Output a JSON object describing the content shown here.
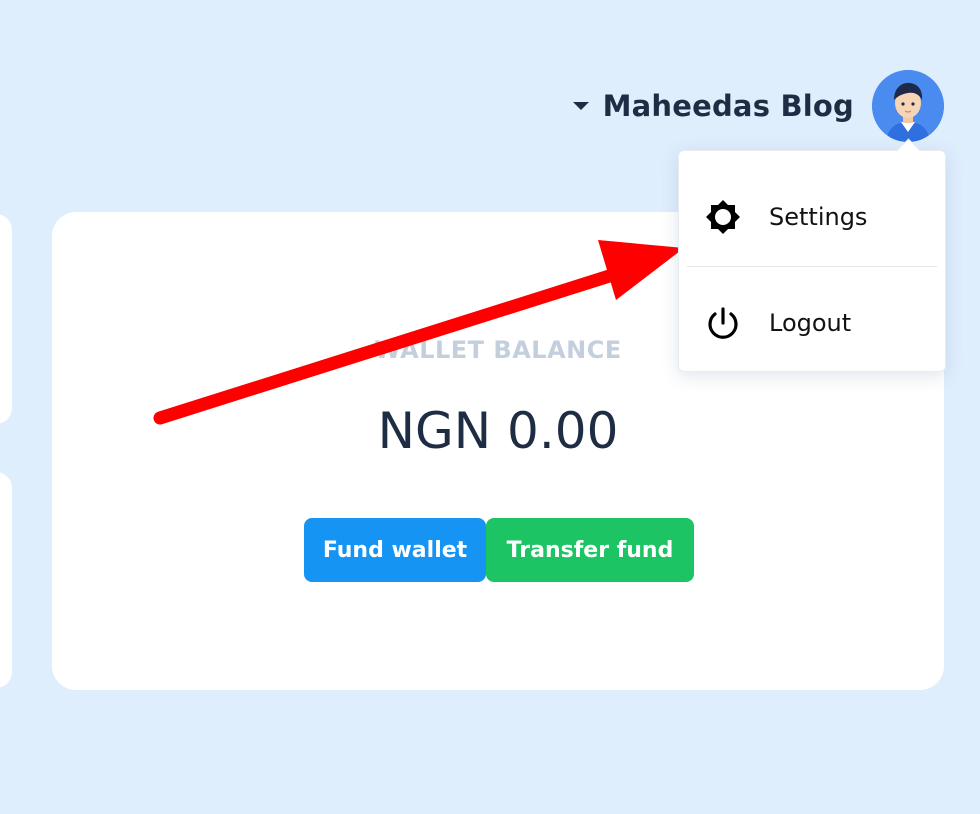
{
  "header": {
    "user_name": "Maheedas Blog",
    "avatar_icon": "user-avatar-icon"
  },
  "wallet": {
    "label": "WALLET BALANCE",
    "amount": "NGN 0.00",
    "fund_button": "Fund wallet",
    "transfer_button": "Transfer fund"
  },
  "dropdown": {
    "items": [
      {
        "label": "Settings",
        "icon": "gear-icon"
      },
      {
        "label": "Logout",
        "icon": "power-icon"
      }
    ]
  },
  "colors": {
    "background": "#dfeefd",
    "text_dark": "#1f2d44",
    "fund_button": "#1594f4",
    "transfer_button": "#1cc463",
    "annotation_arrow": "#ff0000"
  }
}
